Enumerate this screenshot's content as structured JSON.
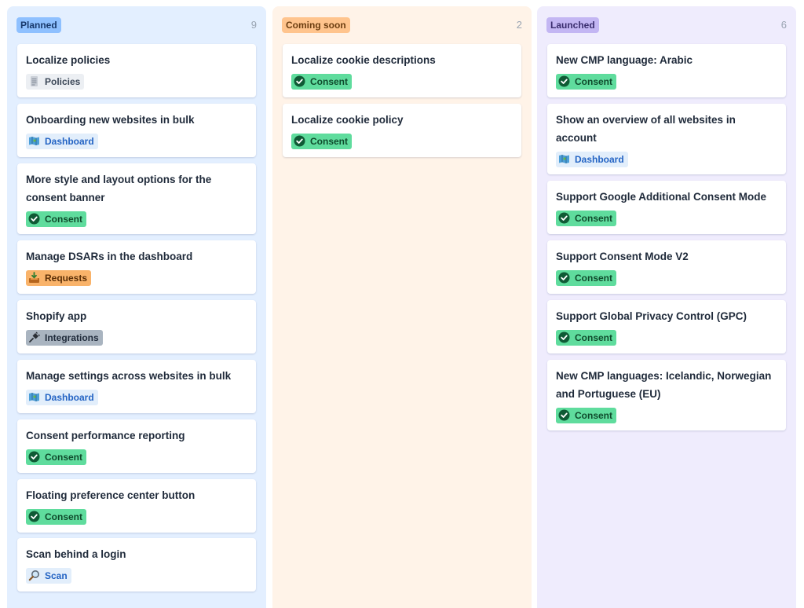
{
  "columns": [
    {
      "status": "Planned",
      "count": "9",
      "cards": [
        {
          "title": "Localize policies",
          "tag": "Policies",
          "tag_icon": "document-icon"
        },
        {
          "title": "Onboarding new websites in bulk",
          "tag": "Dashboard",
          "tag_icon": "map-icon"
        },
        {
          "title": "More style and layout options for the consent banner",
          "tag": "Consent",
          "tag_icon": "check-circle-icon"
        },
        {
          "title": "Manage DSARs in the dashboard",
          "tag": "Requests",
          "tag_icon": "inbox-tray-icon"
        },
        {
          "title": "Shopify app",
          "tag": "Integrations",
          "tag_icon": "plug-icon"
        },
        {
          "title": "Manage settings across websites in bulk",
          "tag": "Dashboard",
          "tag_icon": "map-icon"
        },
        {
          "title": "Consent performance reporting",
          "tag": "Consent",
          "tag_icon": "check-circle-icon"
        },
        {
          "title": "Floating preference center button",
          "tag": "Consent",
          "tag_icon": "check-circle-icon"
        },
        {
          "title": "Scan behind a login",
          "tag": "Scan",
          "tag_icon": "magnifier-icon"
        }
      ]
    },
    {
      "status": "Coming soon",
      "count": "2",
      "cards": [
        {
          "title": "Localize cookie descriptions",
          "tag": "Consent",
          "tag_icon": "check-circle-icon"
        },
        {
          "title": "Localize cookie policy",
          "tag": "Consent",
          "tag_icon": "check-circle-icon"
        }
      ]
    },
    {
      "status": "Launched",
      "count": "6",
      "cards": [
        {
          "title": "New CMP language: Arabic",
          "tag": "Consent",
          "tag_icon": "check-circle-icon"
        },
        {
          "title": "Show an overview of all websites in account",
          "tag": "Dashboard",
          "tag_icon": "map-icon"
        },
        {
          "title": "Support Google Additional Consent Mode",
          "tag": "Consent",
          "tag_icon": "check-circle-icon"
        },
        {
          "title": "Support Consent Mode V2",
          "tag": "Consent",
          "tag_icon": "check-circle-icon"
        },
        {
          "title": "Support Global Privacy Control (GPC)",
          "tag": "Consent",
          "tag_icon": "check-circle-icon"
        },
        {
          "title": "New CMP languages: Icelandic, Norwegian and Portuguese (EU)",
          "tag": "Consent",
          "tag_icon": "check-circle-icon"
        }
      ]
    }
  ],
  "colors": {
    "planned_bg": "#e3efff",
    "coming_soon_bg": "#fff3e8",
    "launched_bg": "#efecfd",
    "consent_tag": "#5fdc9d",
    "dashboard_tag": "#e2eefb",
    "requests_tag": "#f9b36a",
    "integrations_tag": "#a9b4c0"
  }
}
